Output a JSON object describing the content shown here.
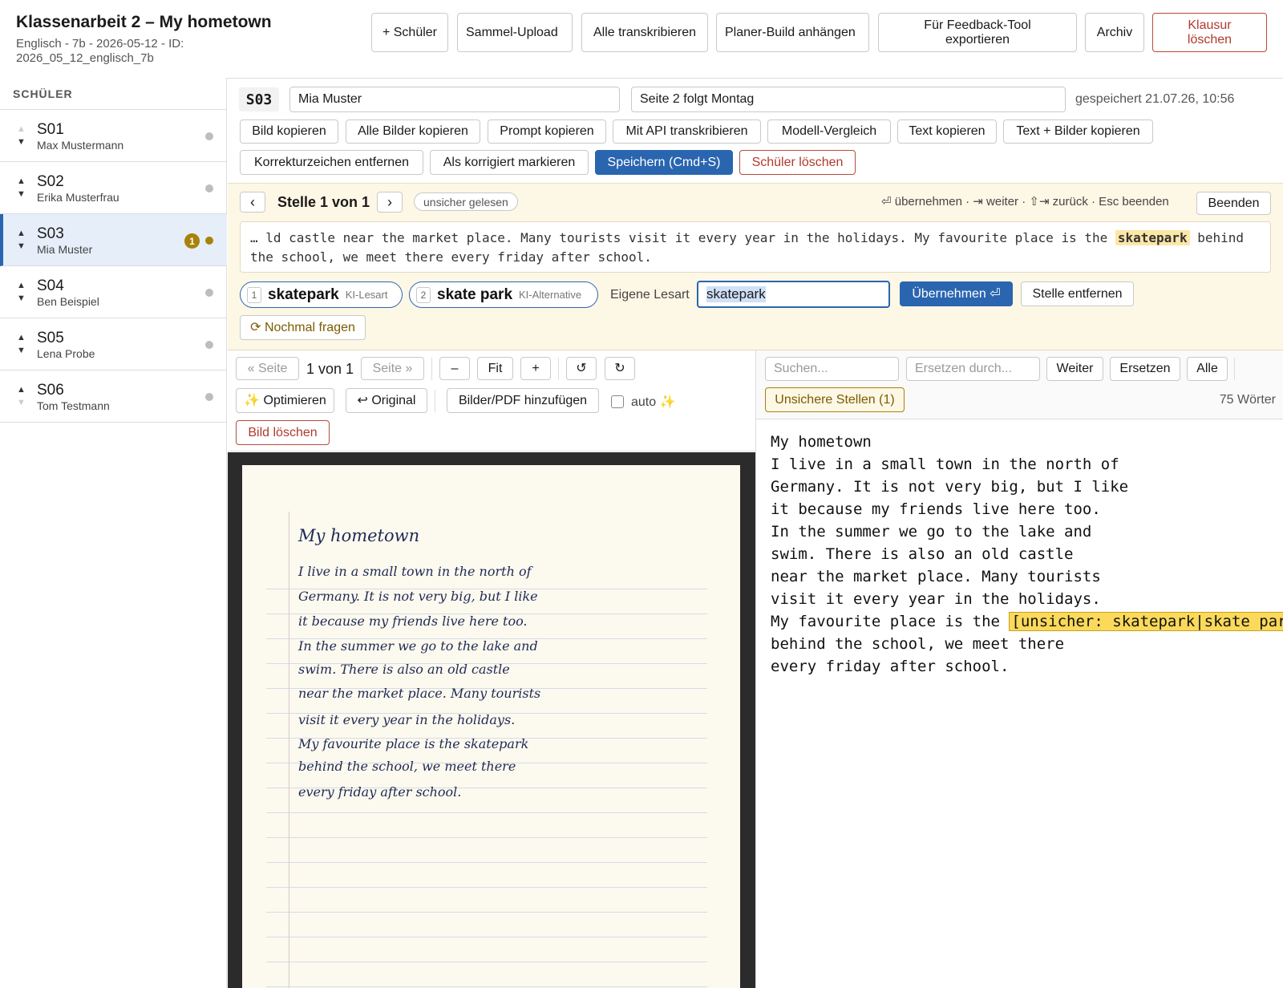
{
  "header": {
    "title": "Klassenarbeit 2 – My hometown",
    "subtitle": "Englisch - 7b - 2026-05-12 - ID: 2026_05_12_englisch_7b",
    "buttons": {
      "add_student": "+ Schüler",
      "bulk_upload": "Sammel-Upload",
      "transcribe_all": "Alle transkribieren",
      "attach_planner": "Planer-Build anhängen",
      "export_feedback": "Für Feedback-Tool exportieren",
      "archive": "Archiv",
      "delete_exam": "Klausur löschen"
    }
  },
  "sidebar": {
    "heading": "SCHÜLER",
    "students": [
      {
        "id": "S01",
        "name": "Max Mustermann"
      },
      {
        "id": "S02",
        "name": "Erika Musterfrau"
      },
      {
        "id": "S03",
        "name": "Mia Muster",
        "badge": "1"
      },
      {
        "id": "S04",
        "name": "Ben Beispiel"
      },
      {
        "id": "S05",
        "name": "Lena Probe"
      },
      {
        "id": "S06",
        "name": "Tom Testmann"
      }
    ]
  },
  "student": {
    "code": "S03",
    "name_value": "Mia Muster",
    "note_value": "Seite 2 folgt Montag",
    "saved": "gespeichert 21.07.26, 10:56"
  },
  "actions": {
    "copy_image": "Bild kopieren",
    "copy_all_images": "Alle Bilder kopieren",
    "copy_prompt": "Prompt kopieren",
    "api_transcribe": "Mit API transkribieren",
    "model_compare": "Modell-Vergleich",
    "copy_text": "Text kopieren",
    "copy_text_images": "Text + Bilder kopieren",
    "remove_marks": "Korrekturzeichen entfernen",
    "mark_corrected": "Als korrigiert markieren",
    "save": "Speichern (Cmd+S)",
    "delete_student": "Schüler löschen"
  },
  "review": {
    "prev": "‹",
    "next": "›",
    "position": "Stelle 1 von 1",
    "tag": "unsicher gelesen",
    "shortcuts": "⏎ übernehmen · ⇥ weiter · ⇧⇥ zurück · Esc beenden",
    "end": "Beenden",
    "context_before": "… ld castle near the market place. Many tourists visit it every year in the holidays. My favourite place is the ",
    "context_highlight": "skatepark",
    "context_after": " behind the school, we meet there every friday after school.",
    "option1": {
      "key": "1",
      "label": "skatepark",
      "kind": "KI-Lesart"
    },
    "option2": {
      "key": "2",
      "label": "skate park",
      "kind": "KI-Alternative"
    },
    "own_label": "Eigene Lesart",
    "own_value": "skatepark",
    "accept": "Übernehmen ⏎",
    "remove": "Stelle entfernen",
    "ask_again": "⟳ Nochmal fragen"
  },
  "viewer": {
    "prev_page": "« Seite",
    "page_info": "1 von 1",
    "next_page": "Seite »",
    "zoom_out": "–",
    "fit": "Fit",
    "zoom_in": "+",
    "rotate_left": "↺",
    "rotate_right": "↻",
    "optimize": "✨ Optimieren",
    "original": "↩ Original",
    "add_files": "Bilder/PDF hinzufügen",
    "auto": "auto ✨",
    "delete_image": "Bild löschen"
  },
  "handwriting": [
    "My hometown",
    "I live in a small town in the north of",
    "Germany. It is not very big, but I like",
    "it because my friends live here too.",
    "In the summer we go to the lake and",
    "swim. There is also an old castle",
    "near the market place. Many tourists",
    "visit it every year in the holidays.",
    "My favourite place is the skatepark",
    "behind the school, we meet there",
    "every friday after school."
  ],
  "editor": {
    "search_placeholder": "Suchen...",
    "replace_placeholder": "Ersetzen durch...",
    "next": "Weiter",
    "replace": "Ersetzen",
    "all": "Alle",
    "uncertain": "Unsichere Stellen (1)",
    "word_count": "75 Wörter",
    "transcript_before": "My hometown\nI live in a small town in the north of\nGermany. It is not very big, but I like\nit because my friends live here too.\nIn the summer we go to the lake and\nswim. There is also an old castle\nnear the market place. Many tourists\nvisit it every year in the holidays.\nMy favourite place is the ",
    "transcript_highlight": "[unsicher: skatepark|skate park]",
    "transcript_after": "\nbehind the school, we meet there\nevery friday after school."
  }
}
